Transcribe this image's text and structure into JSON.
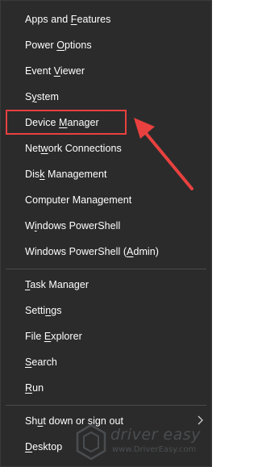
{
  "menu": {
    "items": [
      {
        "pre": "Apps and ",
        "acc": "F",
        "post": "eatures"
      },
      {
        "pre": "Power ",
        "acc": "O",
        "post": "ptions"
      },
      {
        "pre": "Event ",
        "acc": "V",
        "post": "iewer"
      },
      {
        "pre": "S",
        "acc": "y",
        "post": "stem"
      },
      {
        "pre": "Device ",
        "acc": "M",
        "post": "anager"
      },
      {
        "pre": "Net",
        "acc": "w",
        "post": "ork Connections"
      },
      {
        "pre": "Dis",
        "acc": "k",
        "post": " Management"
      },
      {
        "pre": "Computer Mana",
        "acc": "g",
        "post": "ement"
      },
      {
        "pre": "W",
        "acc": "i",
        "post": "ndows PowerShell"
      },
      {
        "pre": "Windows PowerShell (",
        "acc": "A",
        "post": "dmin)"
      },
      {
        "pre": "",
        "acc": "T",
        "post": "ask Manager"
      },
      {
        "pre": "Setti",
        "acc": "n",
        "post": "gs"
      },
      {
        "pre": "File ",
        "acc": "E",
        "post": "xplorer"
      },
      {
        "pre": "",
        "acc": "S",
        "post": "earch"
      },
      {
        "pre": "",
        "acc": "R",
        "post": "un"
      },
      {
        "pre": "Sh",
        "acc": "u",
        "post": "t down or sign out"
      },
      {
        "pre": "",
        "acc": "D",
        "post": "esktop"
      }
    ]
  },
  "annotation": {
    "highlighted_item": "Device Manager",
    "color": "#e8413f"
  },
  "watermark": {
    "brand": "driver easy",
    "url": "www.DriverEasy.com"
  },
  "colors": {
    "menu_bg": "#2b2b2b",
    "text": "#ffffff",
    "separator": "#4a4a4a"
  }
}
